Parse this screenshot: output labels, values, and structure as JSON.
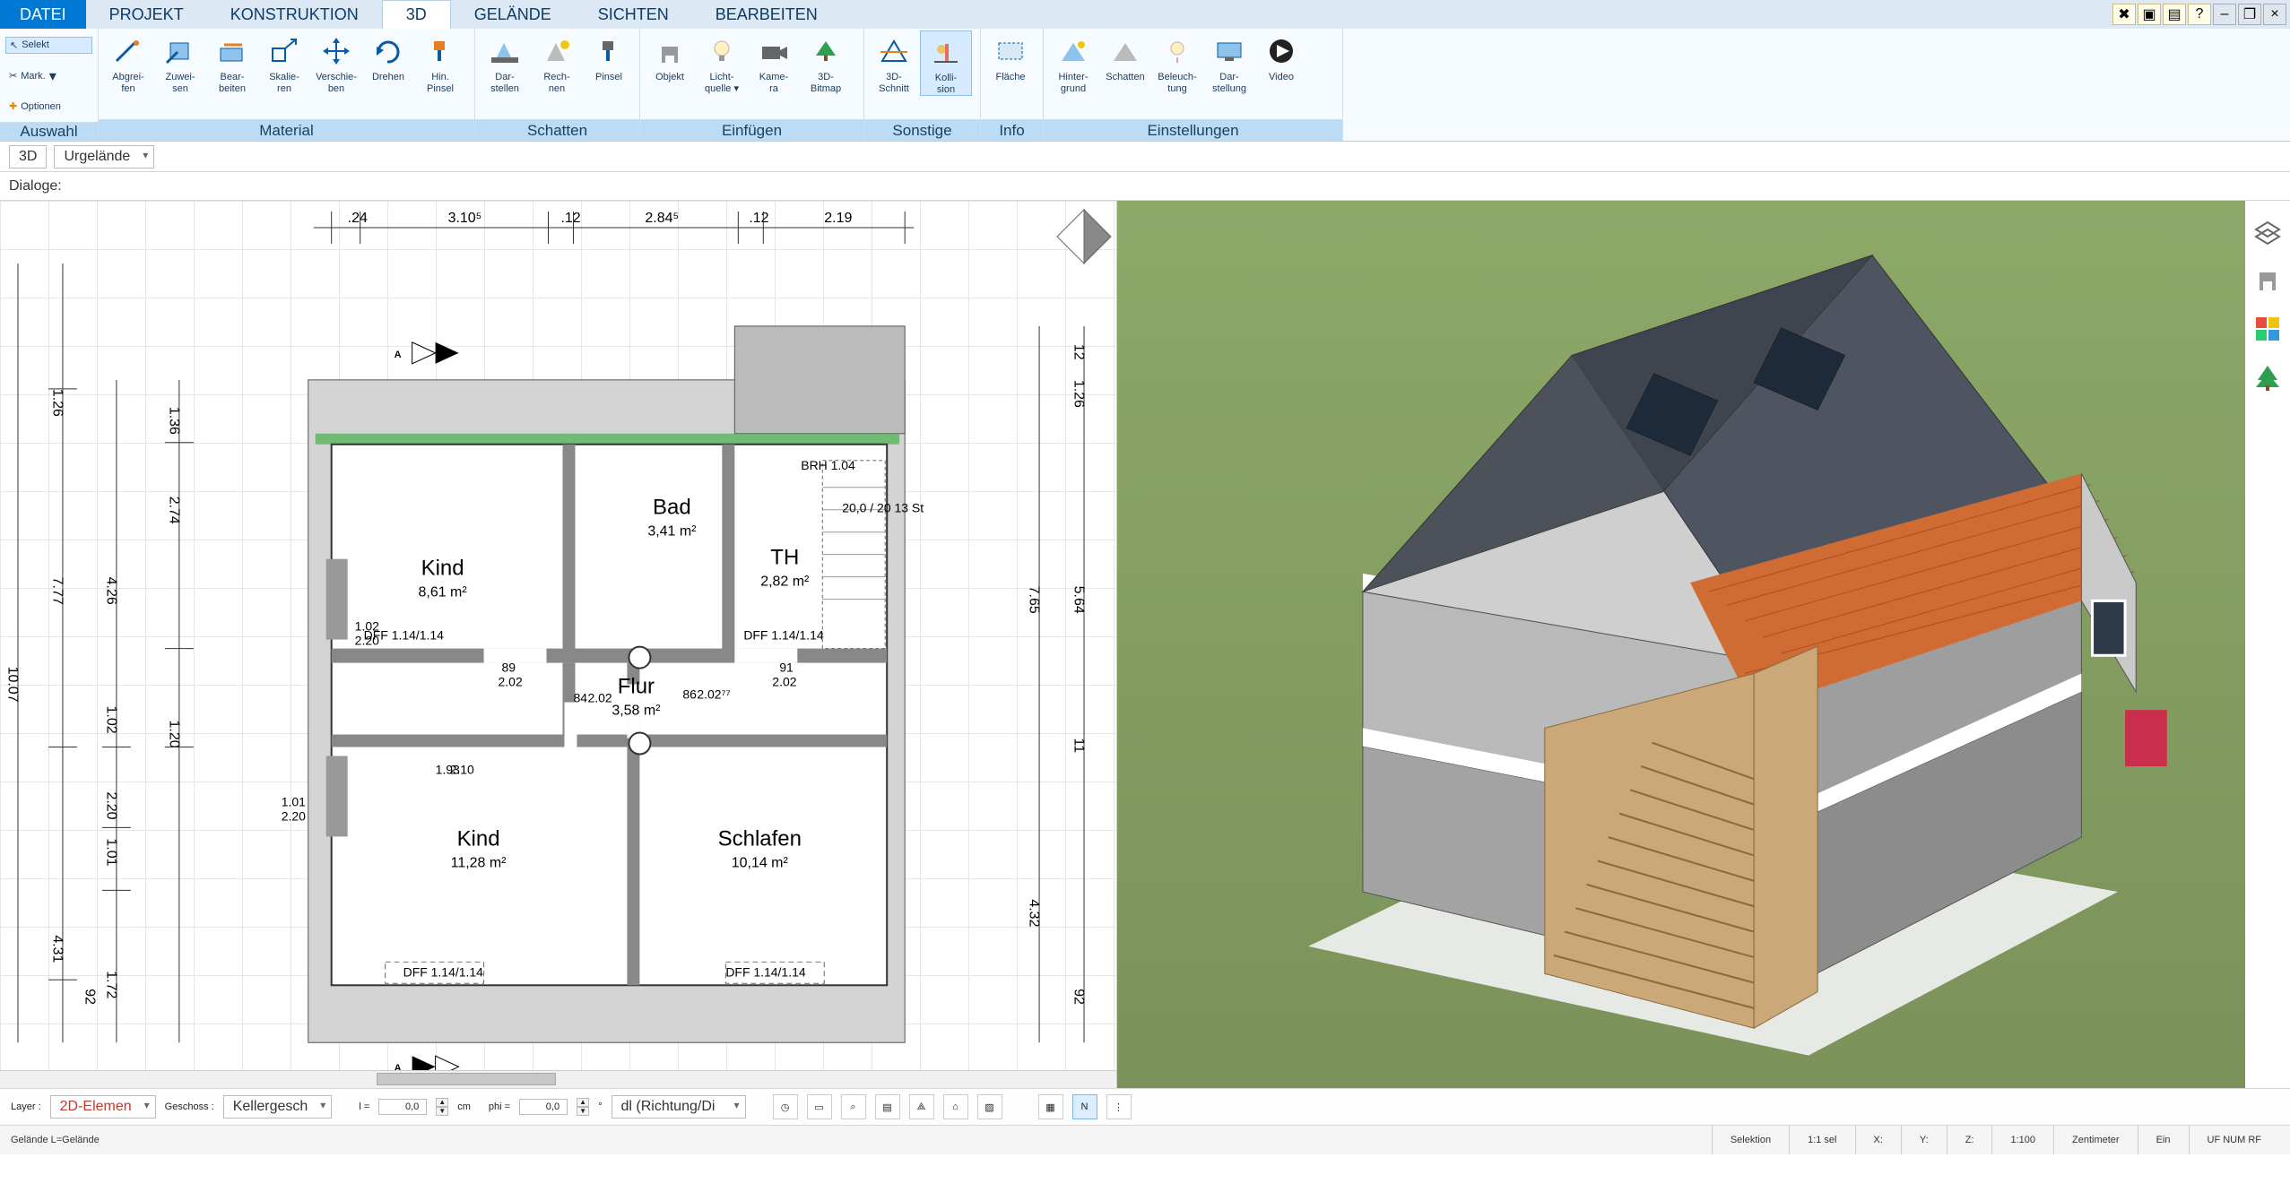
{
  "menu": {
    "tabs": [
      "DATEI",
      "PROJEKT",
      "KONSTRUKTION",
      "3D",
      "GELÄNDE",
      "SICHTEN",
      "BEARBEITEN"
    ],
    "active_index": 3
  },
  "titlebar_icons": [
    "settings",
    "window",
    "tile",
    "help",
    "minimize",
    "maximize",
    "close"
  ],
  "auswahl": {
    "selekt": "Selekt",
    "mark": "Mark.",
    "optionen": "Optionen",
    "group_label": "Auswahl"
  },
  "ribbon": {
    "groups": [
      {
        "label": "Material",
        "buttons": [
          {
            "id": "abgreifen",
            "l1": "Abgrei-",
            "l2": "fen"
          },
          {
            "id": "zuweisen",
            "l1": "Zuwei-",
            "l2": "sen"
          },
          {
            "id": "bearbeiten",
            "l1": "Bear-",
            "l2": "beiten"
          },
          {
            "id": "skalieren",
            "l1": "Skalie-",
            "l2": "ren"
          },
          {
            "id": "verschieben",
            "l1": "Verschie-",
            "l2": "ben"
          },
          {
            "id": "drehen",
            "l1": "Drehen",
            "l2": ""
          },
          {
            "id": "hinpinsel",
            "l1": "Hin.",
            "l2": "Pinsel"
          }
        ]
      },
      {
        "label": "Schatten",
        "buttons": [
          {
            "id": "darstellen",
            "l1": "Dar-",
            "l2": "stellen"
          },
          {
            "id": "rechnen",
            "l1": "Rech-",
            "l2": "nen"
          },
          {
            "id": "pinsel",
            "l1": "Pinsel",
            "l2": ""
          }
        ]
      },
      {
        "label": "Einfügen",
        "buttons": [
          {
            "id": "objekt",
            "l1": "Objekt",
            "l2": ""
          },
          {
            "id": "lichtquelle",
            "l1": "Licht-",
            "l2": "quelle ▾"
          },
          {
            "id": "kamera",
            "l1": "Kame-",
            "l2": "ra"
          },
          {
            "id": "bitmap3d",
            "l1": "3D-",
            "l2": "Bitmap"
          }
        ]
      },
      {
        "label": "Sonstige",
        "buttons": [
          {
            "id": "schnitt3d",
            "l1": "3D-",
            "l2": "Schnitt"
          },
          {
            "id": "kollision",
            "l1": "Kolli-",
            "l2": "sion",
            "active": true
          }
        ]
      },
      {
        "label": "Info",
        "buttons": [
          {
            "id": "flaeche",
            "l1": "Fläche",
            "l2": ""
          }
        ]
      },
      {
        "label": "Einstellungen",
        "buttons": [
          {
            "id": "hintergrund",
            "l1": "Hinter-",
            "l2": "grund"
          },
          {
            "id": "schatten2",
            "l1": "Schatten",
            "l2": ""
          },
          {
            "id": "beleuchtung",
            "l1": "Beleuch-",
            "l2": "tung"
          },
          {
            "id": "darstellung",
            "l1": "Dar-",
            "l2": "stellung"
          },
          {
            "id": "video",
            "l1": "Video",
            "l2": ""
          }
        ]
      }
    ]
  },
  "subbar": {
    "mode": "3D",
    "terrain": "Urgelände",
    "dialoge": "Dialoge:"
  },
  "floorplan": {
    "compass": "N",
    "top_dims": [
      ".24",
      "3.10⁵",
      ".12",
      "2.84⁵",
      ".12",
      "2.19"
    ],
    "rooms": [
      {
        "name": "Kind",
        "area": "8,61 m²"
      },
      {
        "name": "Bad",
        "area": "3,41 m²"
      },
      {
        "name": "TH",
        "area": "2,82 m²"
      },
      {
        "name": "Flur",
        "area": "3,58 m²"
      },
      {
        "name": "Kind",
        "area": "11,28 m²"
      },
      {
        "name": "Schlafen",
        "area": "10,14 m²"
      }
    ],
    "brh": "BRH 1.04",
    "dff_top": "DFF  1.14/1.14",
    "dff_top2": "DFF 1.14/1.14",
    "dff_bot1": "DFF  1.14/1.14",
    "dff_bot2": "DFF  1.14/1.14",
    "stair_note": "20,0 / 20\n13 St",
    "d89": "89",
    "d202": "2.02",
    "d84": "84",
    "d202b": "2.02",
    "d86": "86",
    "d2027": "2.02⁷⁷",
    "d91": "91",
    "d202c": "2.02",
    "d101": "1.01",
    "d220": "2.20",
    "d193": "1.93",
    "d210": "2.10",
    "d102": "1.02",
    "d220b": "2.20",
    "left_outer": "10.07",
    "left_a": "4.31",
    "left_b": "7.77",
    "left_c": "1.72",
    "left_d": "1.01",
    "left_e": "2.20",
    "left_f": "1.02",
    "left_g": "4.26",
    "left_h": "1.20",
    "left_i": "2.74",
    "left_j": "1.36",
    "left_k": "1.26",
    "right_a": "4.32",
    "right_b": "7.65",
    "right_c": "5.64",
    "right_d": "1.26",
    "r92": "92",
    "r11": "11",
    "r12": "12"
  },
  "side_tools": [
    "layers",
    "chair",
    "palette",
    "tree"
  ],
  "params": {
    "layer_lbl": "Layer :",
    "layer_val": "2D-Elemen",
    "geschoss_lbl": "Geschoss :",
    "geschoss_val": "Kellergesch",
    "l_lbl": "l =",
    "l_val": "0,0",
    "l_unit": "cm",
    "phi_lbl": "phi =",
    "phi_val": "0,0",
    "phi_unit": "",
    "richtung": "dl (Richtung/Di"
  },
  "bottom_icons": [
    "clock",
    "monitor",
    "cam",
    "layers2",
    "angle",
    "roof",
    "hatch",
    "grid",
    "north",
    "vline"
  ],
  "status": {
    "left": "Gelände L=Gelände",
    "selektion": "Selektion",
    "sel": "1:1 sel",
    "x": "X:",
    "y": "Y:",
    "z": "Z:",
    "scale": "1:100",
    "unit": "Zentimeter",
    "ein": "Ein",
    "extras": "UF  NUM  RF"
  }
}
